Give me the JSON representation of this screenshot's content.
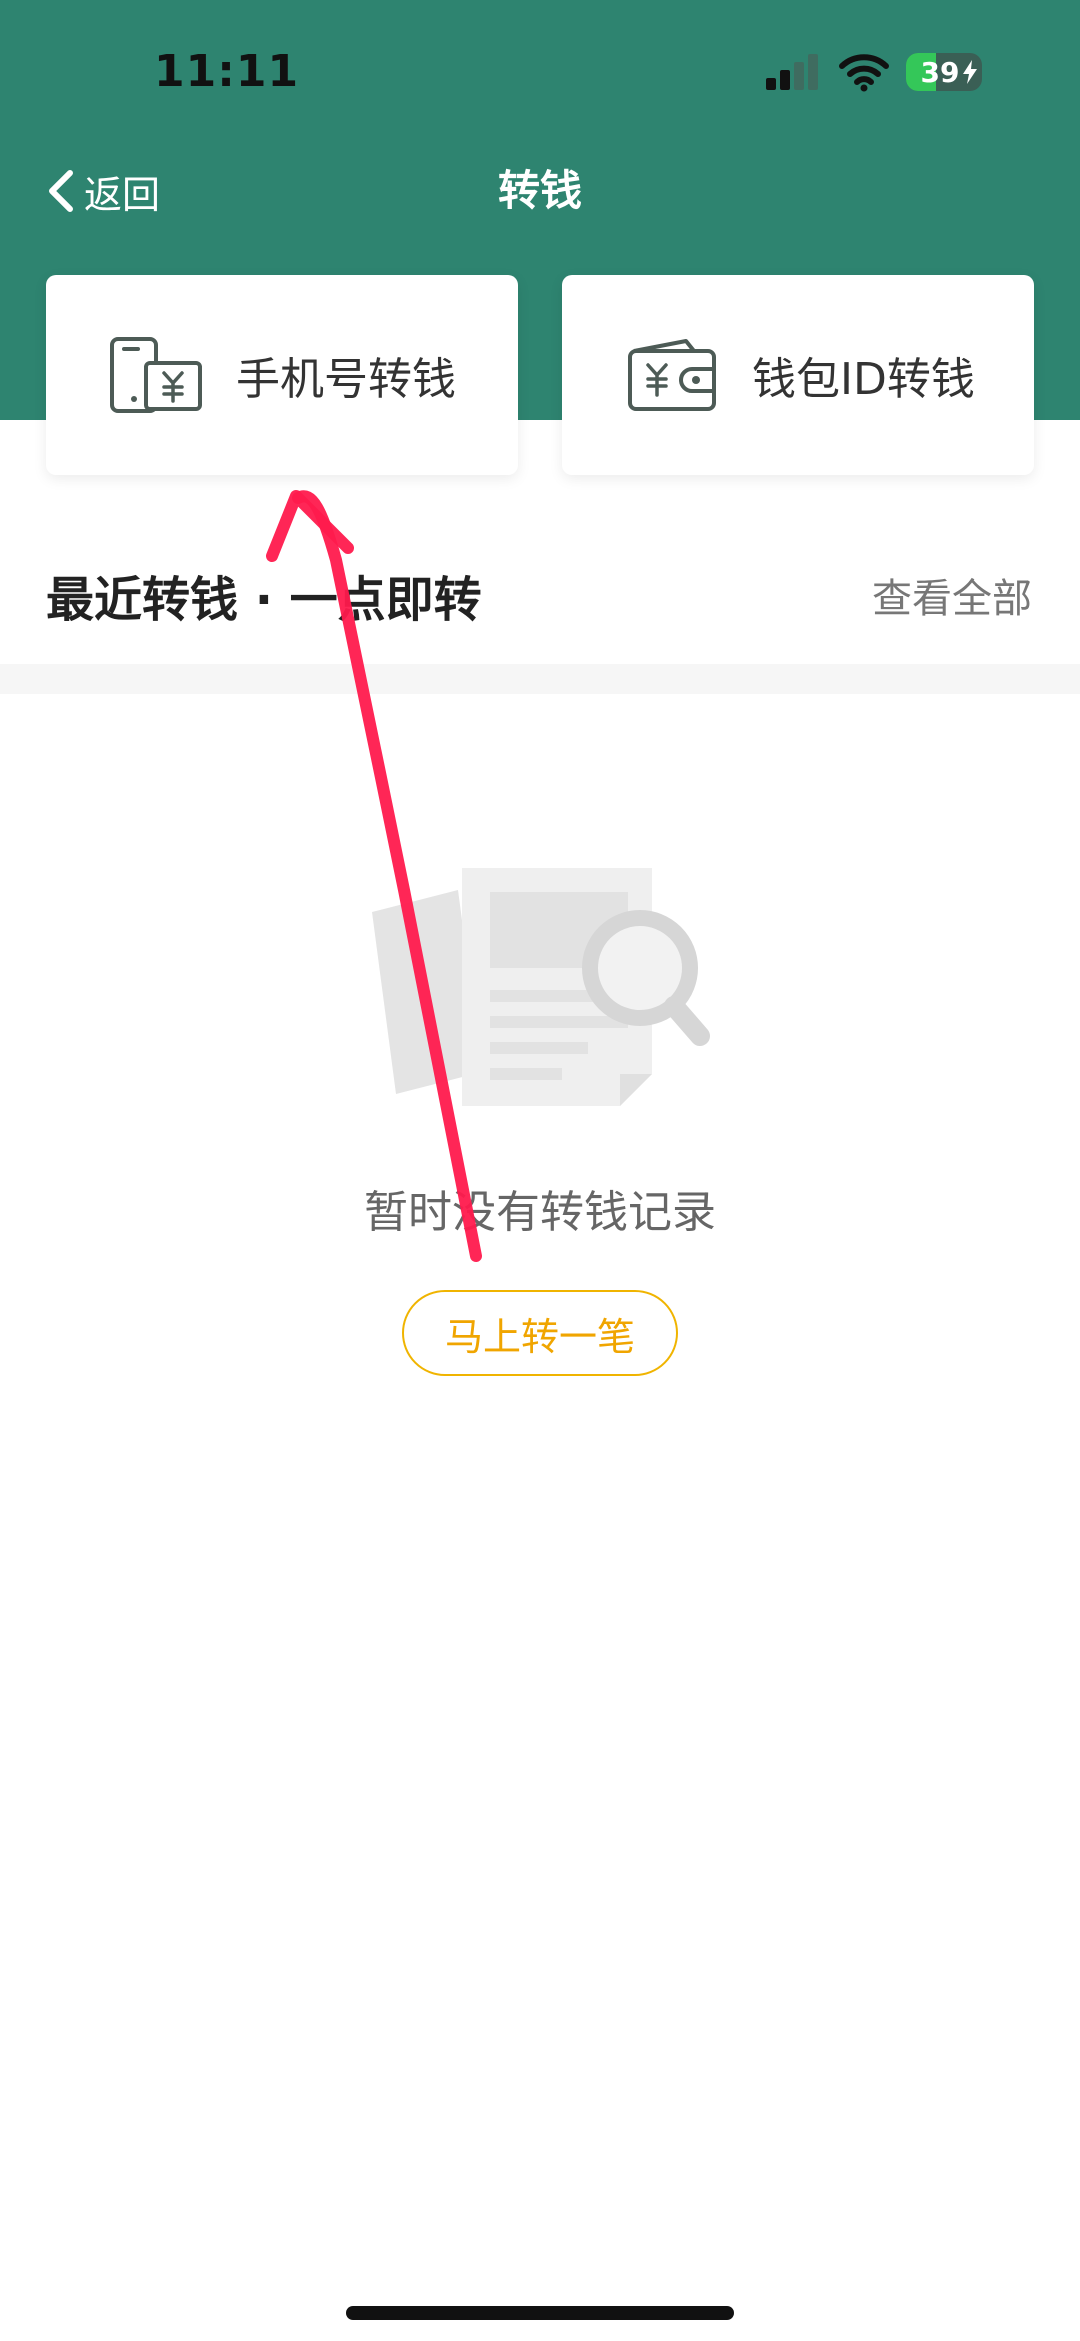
{
  "status_bar": {
    "time": "11:11",
    "battery_level": "39",
    "battery_fraction": 0.39
  },
  "nav": {
    "back_label": "返回",
    "title": "转钱"
  },
  "transfer_options": [
    {
      "label": "手机号转钱",
      "icon": "phone-yuan-icon"
    },
    {
      "label": "钱包ID转钱",
      "icon": "wallet-yuan-icon"
    }
  ],
  "recent": {
    "title": "最近转钱 · 一点即转",
    "view_all_label": "查看全部"
  },
  "empty_state": {
    "icon": "document-search-icon",
    "message": "暂时没有转钱记录",
    "action_label": "马上转一笔"
  },
  "colors": {
    "header_green": "#2e8470",
    "action_orange": "#f0a500",
    "annotation_red": "#ff1a4d",
    "battery_green": "#34c759"
  }
}
